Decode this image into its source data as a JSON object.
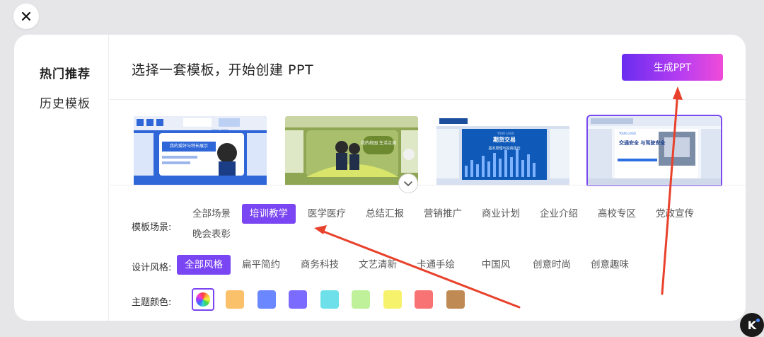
{
  "sidebar": {
    "items": [
      {
        "label": "热门推荐",
        "active": true
      },
      {
        "label": "历史模板",
        "active": false
      }
    ]
  },
  "header": {
    "title": "选择一套模板，开始创建 PPT",
    "generate_button": "生成PPT"
  },
  "templates": [
    {
      "logo": "YOUR LOGO",
      "title": "我的爱好与特长展示",
      "theme": "blue",
      "selected": false
    },
    {
      "logo": "",
      "title": "我的校园 生活点滴",
      "theme": "green",
      "selected": false
    },
    {
      "logo": "YOUR LOGO",
      "title": "期货交易",
      "subtitle": "基本原理与投资技巧",
      "theme": "dark-blue",
      "selected": false
    },
    {
      "logo": "YOUR LOGO",
      "title": "交通安全 与驾驶安全",
      "theme": "white-blue",
      "selected": true
    }
  ],
  "filters": {
    "scene": {
      "label": "模板场景:",
      "options": [
        "全部场景",
        "培训教学",
        "医学医疗",
        "总结汇报",
        "营销推广",
        "商业计划",
        "企业介绍",
        "高校专区",
        "党政宣传",
        "晚会表彰"
      ],
      "selected": "培训教学"
    },
    "style": {
      "label": "设计风格:",
      "options": [
        "全部风格",
        "扁平简约",
        "商务科技",
        "文艺清新",
        "卡通手绘",
        "中国风",
        "创意时尚",
        "创意趣味"
      ],
      "selected": "全部风格"
    },
    "color": {
      "label": "主题颜色:",
      "selected": "all",
      "swatches": [
        "#fbc06a",
        "#6a87ff",
        "#7c6bff",
        "#6ee0ea",
        "#bff09a",
        "#f7f26c",
        "#f87474",
        "#c08a55"
      ]
    }
  },
  "colors": {
    "accent": "#7a45f2",
    "generate_gradient": [
      "#6a2cf0",
      "#ef4bd8"
    ],
    "annotation_arrow": "#e8412c"
  }
}
